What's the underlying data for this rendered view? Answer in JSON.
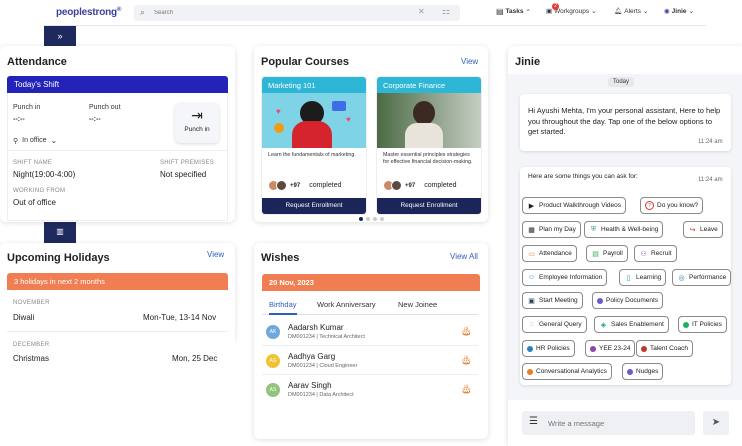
{
  "topbar": {
    "logo": "peoplestrong",
    "search_placeholder": "Search",
    "tasks": "Tasks",
    "workgroups": "Workgroups",
    "workgroups_badge": "2",
    "alerts": "Alerts",
    "jinie": "Jinie"
  },
  "attendance": {
    "title": "Attendance",
    "bar": "Today's Shift",
    "punch_in_label": "Punch in",
    "punch_in_value": "--:--",
    "punch_out_label": "Punch out",
    "punch_out_value": "--:--",
    "location": "In office",
    "punch_button": "Punch in",
    "shift_name_label": "SHIFT NAME",
    "shift_name_value": "Night(19:00-4:00)",
    "shift_premises_label": "SHIFT PREMISES",
    "shift_premises_value": "Not specified",
    "working_from_label": "WORKING FROM",
    "working_from_value": "Out of office"
  },
  "courses": {
    "title": "Popular  Courses",
    "view": "View",
    "items": [
      {
        "header": "Marketing 101",
        "desc": "Learn the fundamentals of marketing.",
        "count": "+97",
        "status": "completed",
        "button": "Request Enrollment",
        "color": "#2eb6d6"
      },
      {
        "header": "Corporate Finance",
        "desc": "Master essential principles strategies for effective financial decision-making.",
        "count": "+97",
        "status": "completed",
        "button": "Request Enrollment",
        "color": "#2eb6d6"
      }
    ]
  },
  "holidays": {
    "title": "Upcoming Holidays",
    "view": "View",
    "bar": "3 holidays in next 2 months",
    "months": [
      {
        "month": "NOVEMBER",
        "name": "Diwali",
        "date": "Mon-Tue, 13-14 Nov"
      },
      {
        "month": "DECEMBER",
        "name": "Christmas",
        "date": "Mon, 25 Dec"
      }
    ]
  },
  "wishes": {
    "title": "Wishes",
    "view_all": "View All",
    "bar": "20 Nov, 2023",
    "tabs": [
      "Birthday",
      "Work Anniversary",
      "New Joinee"
    ],
    "people": [
      {
        "initials": "AK",
        "name": "Aadarsh Kumar",
        "sub": "DM001234 | Technical Architect",
        "color": "#6fa8dc"
      },
      {
        "initials": "AG",
        "name": "Aadhya Garg",
        "sub": "DM001234 | Cloud Engineer",
        "color": "#f1c232"
      },
      {
        "initials": "AS",
        "name": "Aarav Singh",
        "sub": "DM001234 | Data Architect",
        "color": "#93c47d"
      }
    ]
  },
  "jinie": {
    "title": "Jinie",
    "today": "Today",
    "greeting": "Hi Ayushi Mehta, I'm your personal assistant, Here to help you throughout the day. Tap one of the below options to get started.",
    "greeting_time": "11:24 am",
    "prompt": "Here are some things you can ask for:",
    "prompt_time": "11:24 am",
    "chips": [
      "Product Walkthrough Videos",
      "Do you know?",
      "Plan my Day",
      "Health & Well-being",
      "Leave",
      "Attendance",
      "Payroll",
      "Recruit",
      "Employee Information",
      "Learning",
      "Performance",
      "Start Meeting",
      "Policy Documents",
      "General Query",
      "Sales Enablement",
      "IT Policies",
      "HR Policies",
      "YEE 23-24",
      "Talent Coach",
      "Conversational Analytics",
      "Nudges"
    ],
    "input_placeholder": "Write a message"
  }
}
